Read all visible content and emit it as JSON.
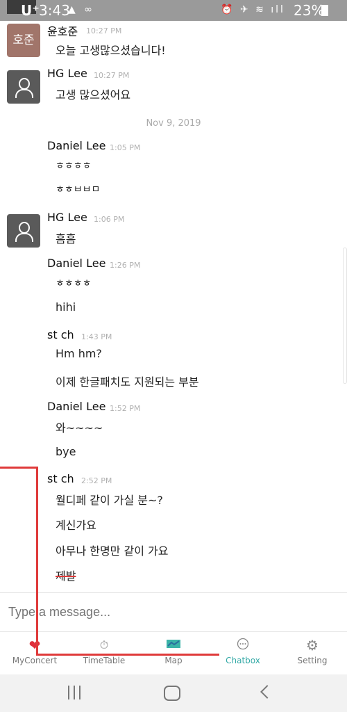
{
  "status_bar": {
    "carrier": "U⁺",
    "time": "3:43",
    "battery": "23%"
  },
  "chat": {
    "date_separator": "Nov 9, 2019",
    "messages": [
      {
        "sender": "윤호준",
        "avatar_text": "호준",
        "time": "10:27 PM",
        "lines": [
          "오늘 고생많으셨습니다!"
        ]
      },
      {
        "sender": "HG Lee",
        "time": "10:27 PM",
        "lines": [
          "고생 많으셨어요"
        ]
      },
      {
        "sender": "Daniel Lee",
        "time": "1:05 PM",
        "lines": [
          "ㅎㅎㅎㅎ",
          "ㅎㅎㅂㅂㅁ"
        ]
      },
      {
        "sender": "HG Lee",
        "time": "1:06 PM",
        "lines": [
          "흠흠"
        ]
      },
      {
        "sender": "Daniel Lee",
        "time": "1:26 PM",
        "lines": [
          "ㅎㅎㅎㅎ",
          "hihi"
        ]
      },
      {
        "sender": "st ch",
        "time": "1:43 PM",
        "lines": [
          "Hm hm?",
          "이제 한글패치도 지원되는 부분"
        ]
      },
      {
        "sender": "Daniel Lee",
        "time": "1:52 PM",
        "lines": [
          "와~~~~",
          "bye"
        ]
      },
      {
        "sender": "st ch",
        "time": "2:52 PM",
        "lines": [
          "월디페 같이 가실 분~?",
          "계신가요",
          "아무나 한명만 같이 가요",
          "제발"
        ]
      }
    ]
  },
  "input": {
    "placeholder": "Type a message..."
  },
  "tabs": [
    {
      "label": "MyConcert",
      "icon": "heart-icon"
    },
    {
      "label": "TimeTable",
      "icon": "stopwatch-icon"
    },
    {
      "label": "Map",
      "icon": "map-icon"
    },
    {
      "label": "Chatbox",
      "icon": "chat-bubble-icon",
      "active": true
    },
    {
      "label": "Setting",
      "icon": "gear-icon"
    }
  ],
  "colors": {
    "accent": "#33a9a6",
    "annotation": "#df3a3a",
    "avatar_brown": "#a1756a",
    "status_bar": "#9a9a9a"
  }
}
